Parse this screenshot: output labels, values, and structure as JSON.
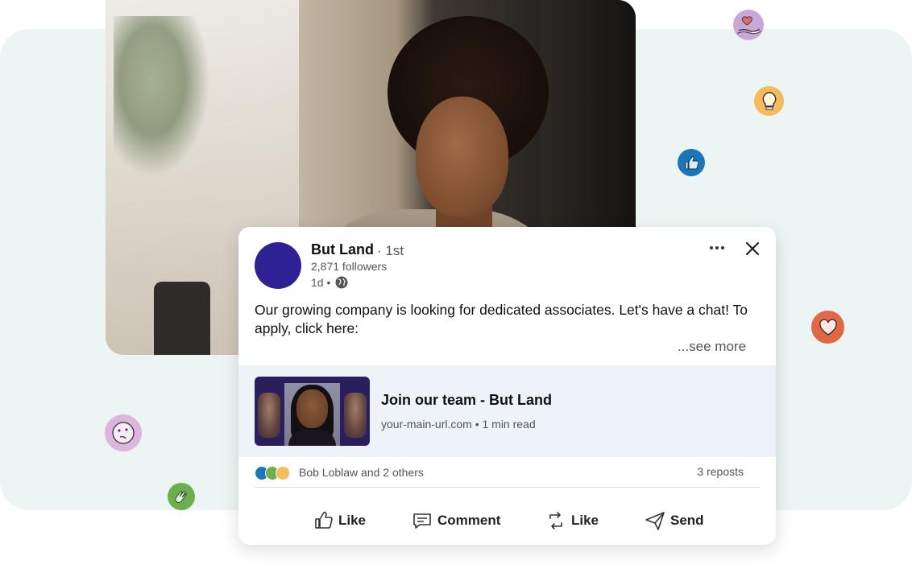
{
  "post": {
    "author_name": "But Land",
    "connection_degree": "· 1st",
    "followers": "2,871 followers",
    "time": "1d •",
    "text": "Our growing company is looking for dedicated associates. Let's have a chat! To apply, click here:",
    "see_more": "...see more"
  },
  "link_preview": {
    "title": "Join our team - But Land",
    "meta": "your-main-url.com • 1 min read"
  },
  "social": {
    "reactors": "Bob Loblaw and 2 others",
    "reposts": "3 reposts"
  },
  "actions": {
    "like": "Like",
    "comment": "Comment",
    "repost": "Like",
    "send": "Send"
  },
  "colors": {
    "avatar": "#2d2194",
    "like_blue": "#1b75bb",
    "heart_orange": "#e16745",
    "insight_yellow": "#f5bb5c",
    "celebrate_green": "#6dae4f",
    "support_purple": "#c8a8d8"
  },
  "icons": [
    "more-icon",
    "close-icon",
    "globe-icon",
    "like-icon",
    "comment-icon",
    "repost-icon",
    "send-icon"
  ]
}
